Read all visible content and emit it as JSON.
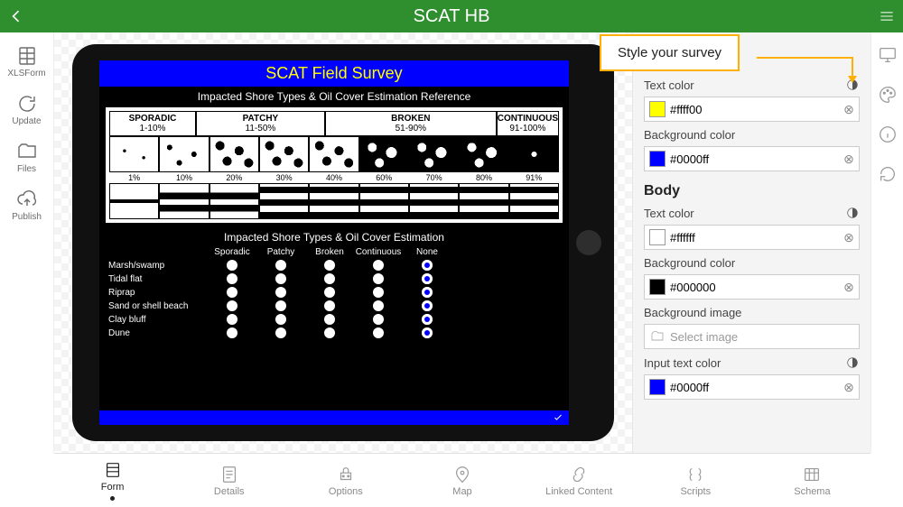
{
  "topbar": {
    "title": "SCAT HB"
  },
  "leftrail": {
    "items": [
      {
        "label": "XLSForm"
      },
      {
        "label": "Update"
      },
      {
        "label": "Files"
      },
      {
        "label": "Publish"
      }
    ]
  },
  "bottomtabs": {
    "items": [
      {
        "label": "Form",
        "active": true
      },
      {
        "label": "Details"
      },
      {
        "label": "Options"
      },
      {
        "label": "Map"
      },
      {
        "label": "Linked Content"
      },
      {
        "label": "Scripts"
      },
      {
        "label": "Schema"
      }
    ]
  },
  "callout": {
    "text": "Style your survey"
  },
  "style_panel": {
    "header_section": {
      "text_color": {
        "label": "Text color",
        "value": "#ffff00"
      },
      "bg_color": {
        "label": "Background color",
        "value": "#0000ff"
      }
    },
    "body_section_title": "Body",
    "body_section": {
      "text_color": {
        "label": "Text color",
        "value": "#ffffff"
      },
      "bg_color": {
        "label": "Background color",
        "value": "#000000"
      },
      "bg_image": {
        "label": "Background image",
        "placeholder": "Select image"
      },
      "input_text": {
        "label": "Input text color",
        "value": "#0000ff"
      }
    }
  },
  "survey_preview": {
    "title": "SCAT Field Survey",
    "subtitle": "Impacted Shore Types & Oil Cover Estimation Reference",
    "ref_headers": [
      {
        "name": "SPORADIC",
        "range": "1-10%",
        "width": 2
      },
      {
        "name": "PATCHY",
        "range": "11-50%",
        "width": 3
      },
      {
        "name": "BROKEN",
        "range": "51-90%",
        "width": 4
      },
      {
        "name": "CONTINUOUS",
        "range": "91-100%",
        "width": 1
      }
    ],
    "pct_labels": [
      "1%",
      "10%",
      "20%",
      "30%",
      "40%",
      "60%",
      "70%",
      "80%",
      "91%"
    ],
    "question_title": "Impacted Shore Types & Oil Cover Estimation",
    "columns": [
      "Sporadic",
      "Patchy",
      "Broken",
      "Continuous",
      "None"
    ],
    "rows": [
      "Marsh/swamp",
      "Tidal flat",
      "Riprap",
      "Sand or shell beach",
      "Clay bluff",
      "Dune"
    ],
    "selected_col_index": 4
  }
}
